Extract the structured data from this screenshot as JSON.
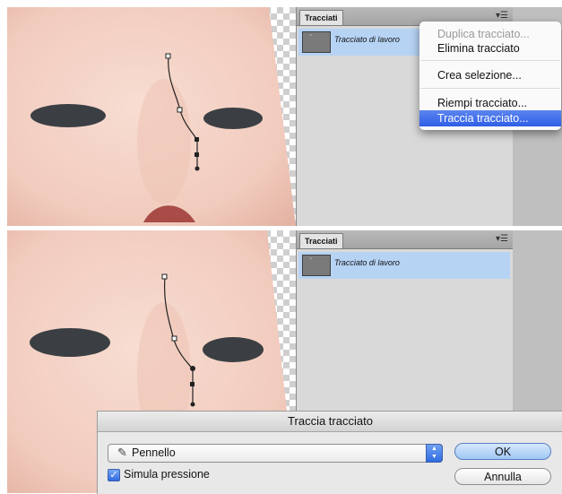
{
  "top": {
    "panel": {
      "tab_label": "Tracciati",
      "menu_icon": "panel-menu-icon",
      "path_name": "Tracciato di lavoro"
    },
    "context_menu": {
      "items": [
        {
          "label": "Duplica tracciato...",
          "enabled": false
        },
        {
          "label": "Elimina tracciato",
          "enabled": true
        },
        {
          "label": "Crea selezione...",
          "enabled": true
        },
        {
          "label": "Riempi tracciato...",
          "enabled": true
        },
        {
          "label": "Traccia tracciato...",
          "enabled": true,
          "highlighted": true
        }
      ]
    }
  },
  "bottom": {
    "panel": {
      "tab_label": "Tracciati",
      "menu_icon": "panel-menu-icon",
      "path_name": "Tracciato di lavoro"
    },
    "dialog": {
      "title": "Traccia tracciato",
      "tool_select": {
        "value": "Pennello",
        "icon": "brush-icon"
      },
      "simulate_pressure": {
        "label": "Simula pressione",
        "checked": true
      },
      "ok_label": "OK",
      "cancel_label": "Annulla"
    }
  },
  "colors": {
    "selection_blue": "#b6d3f4",
    "menu_highlight": "#3b6ae6",
    "skin": "#f1cbbd"
  }
}
